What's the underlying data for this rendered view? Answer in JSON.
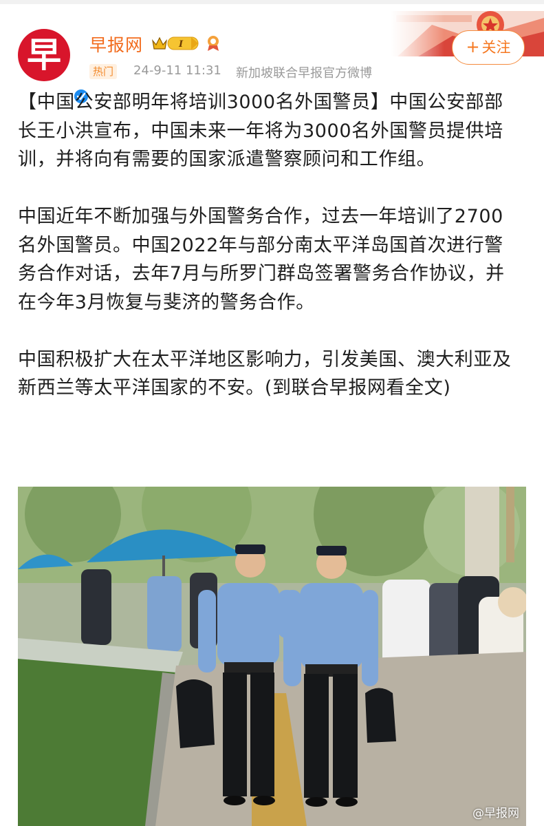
{
  "post": {
    "author": {
      "name": "早报网",
      "avatar_char": "早",
      "vip_level": "I",
      "hot_tag": "热门",
      "time": "24-9-11 11:31",
      "source": "新加坡联合早报官方微博"
    },
    "follow": {
      "plus": "+",
      "label": "关注"
    },
    "paragraphs": [
      "【中国公安部明年将培训3000名外国警员】中国公安部部长王小洪宣布，中国未来一年将为3000名外国警员提供培训，并将向有需要的国家派遣警察顾问和工作组。",
      "中国近年不断加强与外国警务合作，过去一年培训了2700名外国警员。中国2022年与部分南太平洋岛国首次进行警务合作对话，去年7月与所罗门群岛签署警务合作协议，并在今年3月恢复与斐济的警务合作。"
    ],
    "last_paragraph": "中国积极扩大在太平洋地区影响力，引发美国、澳大利亚及新西兰等太平洋国家的不安。",
    "read_more": "(到联合早报网看全文)",
    "image": {
      "watermark": "@早报网"
    }
  },
  "colors": {
    "brand_red": "#d8152b",
    "username_orange": "#f26b1c",
    "follow_orange": "#f5771f",
    "verified_blue": "#1d8cf0"
  }
}
